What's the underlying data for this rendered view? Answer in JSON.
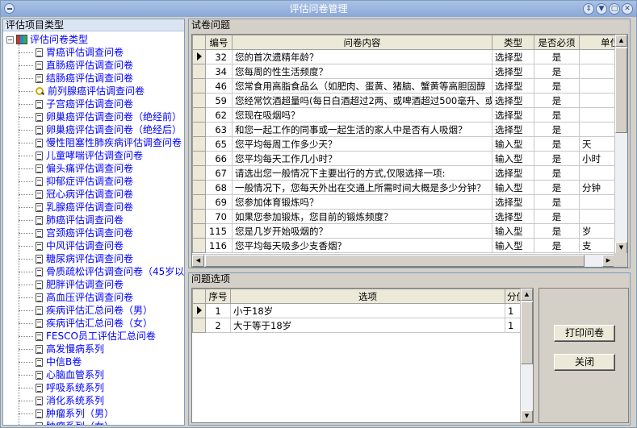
{
  "window": {
    "title": "评估问卷管理"
  },
  "left": {
    "header": "评估项目类型",
    "root_label": "评估问卷类型",
    "items": [
      "胃癌评估调查问卷",
      "直肠癌评估调查问卷",
      "结肠癌评估调查问卷",
      "前列腺癌评估调查问卷",
      "子宫癌评估调查问卷",
      "卵巢癌评估调查问卷（绝经前）",
      "卵巢癌评估调查问卷（绝经后）",
      "慢性阻塞性肺疾病评估调查问卷",
      "儿童哮喘评估调查问卷",
      "偏头痛评估调查问卷",
      "抑郁症评估调查问卷",
      "冠心病评估调查问卷",
      "乳腺癌评估调查问卷",
      "肺癌评估调查问卷",
      "宫颈癌评估调查问卷",
      "中风评估调查问卷",
      "糖尿病评估调查问卷",
      "骨质疏松评估调查问卷（45岁以",
      "肥胖评估调查问卷",
      "高血压评估调查问卷",
      "疾病评估汇总问卷（男）",
      "疾病评估汇总问卷（女）",
      "FESCO员工评估汇总问卷",
      "高发慢病系列",
      "中信B卷",
      "心脑血管系列",
      "呼吸系统系列",
      "消化系统系列",
      "肿瘤系列（男）",
      "肿瘤系列（女）"
    ]
  },
  "questions": {
    "header": "试卷问题",
    "columns": [
      "编号",
      "问卷内容",
      "类型",
      "是否必须",
      "单位"
    ],
    "rows": [
      [
        "32",
        "您的首次遗精年龄？",
        "选择型",
        "是",
        ""
      ],
      [
        "34",
        "您每周的性生活频度？",
        "选择型",
        "是",
        ""
      ],
      [
        "46",
        "您常食用高脂食品么（如肥肉、蛋黄、猪脑、蟹黄等高胆固醇",
        "选择型",
        "是",
        ""
      ],
      [
        "59",
        "您经常饮酒超量吗(每日白酒超过2两、或啤酒超过500毫升、或",
        "选择型",
        "是",
        ""
      ],
      [
        "62",
        "您现在吸烟吗？",
        "选择型",
        "是",
        ""
      ],
      [
        "63",
        "和您一起工作的同事或一起生活的家人中是否有人吸烟？",
        "选择型",
        "是",
        ""
      ],
      [
        "65",
        "您平均每周工作多少天？",
        "输入型",
        "是",
        "天"
      ],
      [
        "66",
        "您平均每天工作几小时？",
        "输入型",
        "是",
        "小时"
      ],
      [
        "67",
        "请选出您一般情况下主要出行的方式,仅限选择一项:",
        "选择型",
        "是",
        ""
      ],
      [
        "68",
        "一般情况下，您每天外出在交通上所需时间大概是多少分钟？",
        "输入型",
        "是",
        "分钟"
      ],
      [
        "69",
        "您参加体育锻炼吗？",
        "选择型",
        "是",
        ""
      ],
      [
        "70",
        "如果您参加锻炼，您目前的锻炼频度？",
        "选择型",
        "是",
        ""
      ],
      [
        "115",
        "您是几岁开始吸烟的？",
        "输入型",
        "是",
        "岁"
      ],
      [
        "116",
        "您平均每天吸多少支香烟？",
        "输入型",
        "是",
        "支"
      ]
    ]
  },
  "options": {
    "header": "问题选项",
    "columns": [
      "序号",
      "选项",
      "分值"
    ],
    "rows": [
      [
        "1",
        "小于18岁",
        "1"
      ],
      [
        "2",
        "大于等于18岁",
        "1"
      ]
    ]
  },
  "buttons": {
    "print": "打印问卷",
    "close": "关闭"
  }
}
